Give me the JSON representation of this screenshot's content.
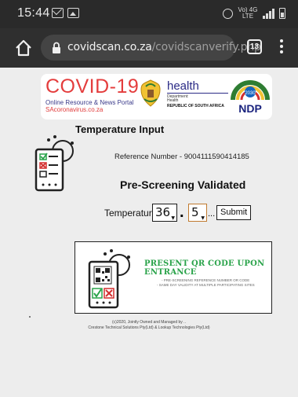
{
  "status_bar": {
    "time": "15:44",
    "network_label": "Vo) 4G LTE",
    "icons": [
      "mail-icon",
      "image-icon",
      "alarm-icon",
      "signal-icon",
      "battery-icon"
    ]
  },
  "browser": {
    "url_host": "covidscan.co.za",
    "url_path": "/covidscanverify.php",
    "tab_count": "13",
    "icons": [
      "home-icon",
      "lock-icon",
      "tabs-icon",
      "more-vert-icon"
    ]
  },
  "banner": {
    "covid_title": "COVID-19",
    "covid_subtitle": "Online Resource & News Portal",
    "covid_site": "SAcoronavirus.co.za",
    "health_word": "health",
    "health_dept_line1": "Department:",
    "health_dept_line2": "Health",
    "health_country": "REPUBLIC OF SOUTH AFRICA",
    "ndp_year": "2030",
    "ndp_label": "NDP"
  },
  "main": {
    "section_title": "Temperature Input",
    "reference_text": "Reference Number - 9004111590414185",
    "status_heading": "Pre-Screening Validated",
    "temperature_label": "Temperature",
    "temperature_whole": "36",
    "decimal_point": ".",
    "temperature_decimal": "5",
    "ellipsis": "...",
    "submit_label": "Submit"
  },
  "qr_notice": {
    "heading": "PRESENT QR CODE UPON ENTRANCE",
    "line1": "- PRE-SCREENING REFERENCE NUMBER OR CODE",
    "line2": "- SAME DAY VALIDITY AT MULTIPLE PARTICIPATING SITES"
  },
  "footer": {
    "line1": "(c)2020, Jointly Owned and Managed by ..",
    "line2": "Crestone Technical Solutions Pty(Ltd) & Lookup Technologies Pty(Ltd)"
  },
  "colors": {
    "status_bar_bg": "#2a2a2a",
    "toolbar_bg": "#2f2f2f",
    "page_bg": "#ededed",
    "covid_red": "#e43d3d",
    "health_blue": "#2b2b86",
    "qr_green": "#2aa34a"
  }
}
